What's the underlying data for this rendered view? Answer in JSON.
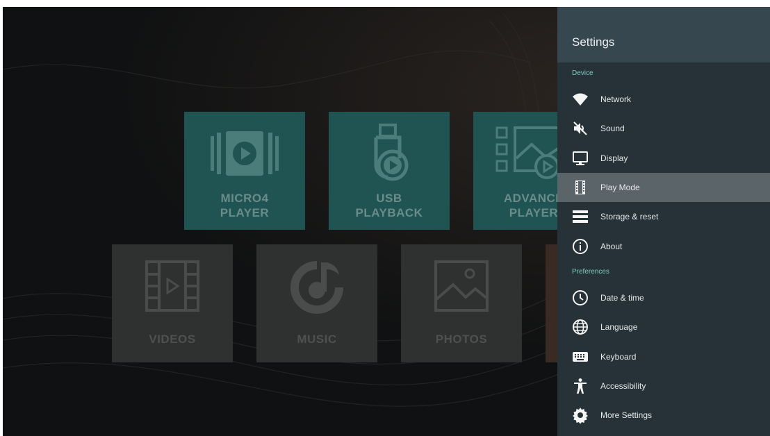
{
  "launcher": {
    "tiles_top": [
      {
        "label": "MICRO4\nPLAYER",
        "icon": "micro4-player-icon"
      },
      {
        "label": "USB\nPLAYBACK",
        "icon": "usb-playback-icon"
      },
      {
        "label": "ADVANCE\nPLAYER",
        "icon": "advance-player-icon"
      }
    ],
    "tiles_bottom": [
      {
        "label": "VIDEOS",
        "icon": "film-icon"
      },
      {
        "label": "MUSIC",
        "icon": "music-note-icon"
      },
      {
        "label": "PHOTOS",
        "icon": "image-icon"
      }
    ]
  },
  "settings": {
    "title": "Settings",
    "sections": [
      {
        "header": "Device",
        "items": [
          {
            "label": "Network",
            "icon": "wifi-icon"
          },
          {
            "label": "Sound",
            "icon": "speaker-muted-icon"
          },
          {
            "label": "Display",
            "icon": "monitor-icon"
          },
          {
            "label": "Play Mode",
            "icon": "film-strip-icon",
            "selected": true
          },
          {
            "label": "Storage & reset",
            "icon": "storage-icon"
          },
          {
            "label": "About",
            "icon": "info-icon"
          }
        ]
      },
      {
        "header": "Preferences",
        "items": [
          {
            "label": "Date & time",
            "icon": "clock-icon"
          },
          {
            "label": "Language",
            "icon": "globe-icon"
          },
          {
            "label": "Keyboard",
            "icon": "keyboard-icon"
          },
          {
            "label": "Accessibility",
            "icon": "accessibility-icon"
          },
          {
            "label": "More Settings",
            "icon": "gear-icon"
          }
        ]
      }
    ]
  },
  "colors": {
    "panel_bg": "#263238",
    "panel_header": "#37474f",
    "section_header": "#80cbc4",
    "selected_row": "#5b6468",
    "teal_tile": "#1f5453",
    "grey_tile": "#2f3030"
  }
}
